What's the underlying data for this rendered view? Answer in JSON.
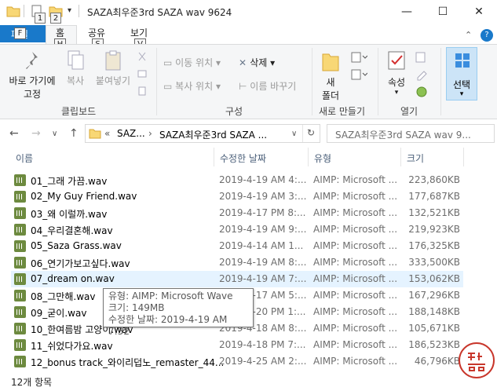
{
  "window": {
    "title": "SAZA최우준3rd SAZA wav 9624",
    "quick_access_keytips": [
      "1",
      "2"
    ],
    "minimize": "—",
    "maximize": "☐",
    "close": "✕"
  },
  "tabs": {
    "file_keytip": "F",
    "file_label": "파일",
    "items": [
      {
        "label": "홈",
        "keytip": "H"
      },
      {
        "label": "공유",
        "keytip": "S"
      },
      {
        "label": "보기",
        "keytip": "V"
      }
    ],
    "help_glyph": "?"
  },
  "ribbon": {
    "pin_label_1": "바로 가기에",
    "pin_label_2": "고정",
    "copy_label": "복사",
    "paste_label": "붙여넣기",
    "clipboard_group": "클립보드",
    "move_to_label": "이동 위치",
    "copy_to_label": "복사 위치",
    "delete_label": "삭제",
    "rename_label": "이름 바꾸기",
    "organize_group": "구성",
    "new_folder_label_1": "새",
    "new_folder_label_2": "폴더",
    "new_group": "새로 만들기",
    "properties_label": "속성",
    "open_group": "열기",
    "select_label": "선택"
  },
  "address": {
    "back": "←",
    "forward": "→",
    "dropdown": "∨",
    "up": "↑",
    "crumb_prefix": "«",
    "crumb_1": "SAZ...",
    "crumb_sep": "›",
    "crumb_2": "SAZA최우준3rd SAZA ...",
    "refresh": "↻",
    "search_placeholder": "SAZA최우준3rd SAZA wav 9..."
  },
  "columns": {
    "name": "이름",
    "date": "수정한 날짜",
    "type": "유형",
    "size": "크기"
  },
  "files": [
    {
      "name": "01_그래 가끔.wav",
      "date": "2019-4-19 AM 4:...",
      "type": "AIMP: Microsoft ...",
      "size": "223,860KB"
    },
    {
      "name": "02_My Guy Friend.wav",
      "date": "2019-4-19 AM 3:...",
      "type": "AIMP: Microsoft ...",
      "size": "177,687KB"
    },
    {
      "name": "03_왜 이럴까.wav",
      "date": "2019-4-17 PM 8:...",
      "type": "AIMP: Microsoft ...",
      "size": "132,521KB"
    },
    {
      "name": "04_우리결혼해.wav",
      "date": "2019-4-19 AM 9:...",
      "type": "AIMP: Microsoft ...",
      "size": "219,923KB"
    },
    {
      "name": "05_Saza Grass.wav",
      "date": "2019-4-14 AM 1...",
      "type": "AIMP: Microsoft ...",
      "size": "176,325KB"
    },
    {
      "name": "06_연기가보고싶다.wav",
      "date": "2019-4-19 AM 8:...",
      "type": "AIMP: Microsoft ...",
      "size": "333,500KB"
    },
    {
      "name": "07_dream on.wav",
      "date": "2019-4-19 AM 7:...",
      "type": "AIMP: Microsoft ...",
      "size": "153,062KB"
    },
    {
      "name": "08_그만해.wav",
      "date": "2019-4-17 AM 5:...",
      "type": "AIMP: Microsoft ...",
      "size": "167,296KB"
    },
    {
      "name": "09_굳이.wav",
      "date": "2019-4-20 PM 1:...",
      "type": "AIMP: Microsoft ...",
      "size": "188,148KB"
    },
    {
      "name": "10_한여름밤 고양이.wav",
      "date": "2019-4-18 AM 8:...",
      "type": "AIMP: Microsoft ...",
      "size": "105,671KB"
    },
    {
      "name": "11_쉬었다가요.wav",
      "date": "2019-4-18 PM 7:...",
      "type": "AIMP: Microsoft ...",
      "size": "186,523KB"
    },
    {
      "name": "12_bonus track_와이리덥노_remaster_44...",
      "date": "2019-4-25 AM 2:...",
      "type": "AIMP: Microsoft ...",
      "size": "46,796KB"
    }
  ],
  "tooltip": {
    "type_line": "유형: AIMP: Microsoft Wave",
    "size_line": "크기: 149MB",
    "date_line": "수정한 날짜: 2019-4-19 AM 7:32"
  },
  "status": {
    "count": "12개 항목"
  },
  "colors": {
    "accent": "#1979ca",
    "selected_row": "#e5f3ff",
    "select_button": "#cce4f7",
    "header_text": "#4c607a"
  }
}
